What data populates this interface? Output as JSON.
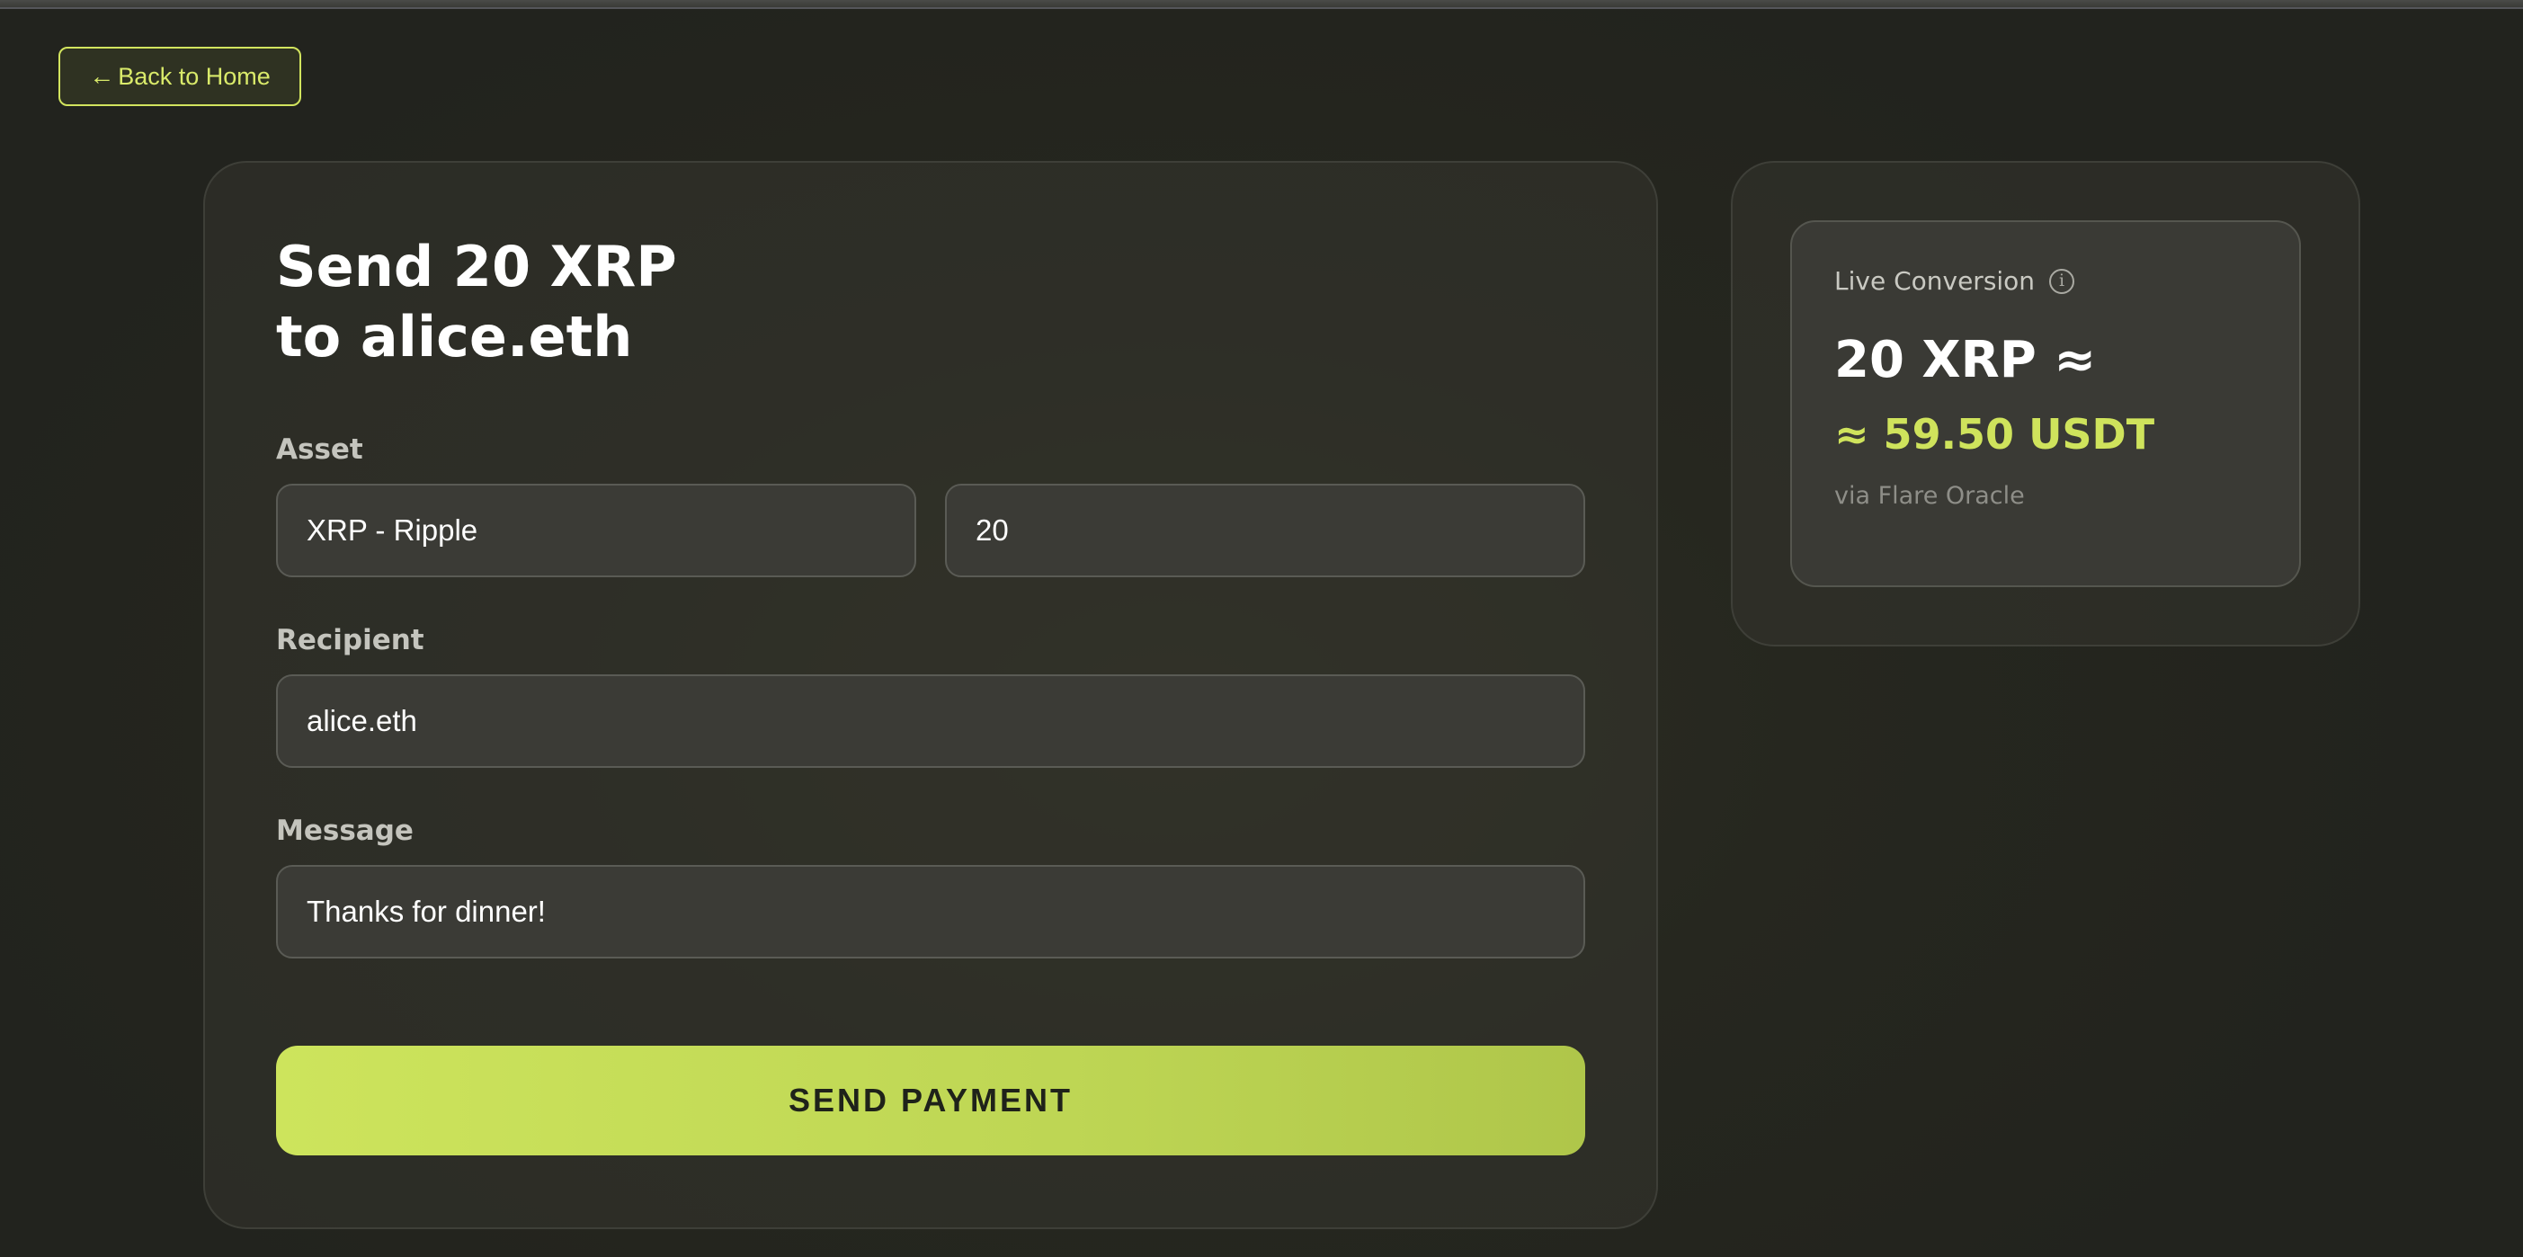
{
  "nav": {
    "back_arrow": "←",
    "back_label": "Back to Home"
  },
  "form": {
    "title_line1": "Send 20 XRP",
    "title_line2": "to alice.eth",
    "asset_label": "Asset",
    "asset_value": "XRP - Ripple",
    "amount_value": "20",
    "recipient_label": "Recipient",
    "recipient_value": "alice.eth",
    "message_label": "Message",
    "message_value": "Thanks for dinner!",
    "send_label": "SEND PAYMENT"
  },
  "conversion": {
    "label": "Live Conversion",
    "info_glyph": "i",
    "amount": "20 XRP ≈",
    "usdt": "≈ 59.50 USDT",
    "source": "via Flare Oracle"
  },
  "colors": {
    "accent": "#cfe35c",
    "background": "#26271f",
    "input_bg": "#3b3b36"
  },
  "icons": {
    "back": "arrow-left-icon",
    "info": "info-circle-icon"
  }
}
